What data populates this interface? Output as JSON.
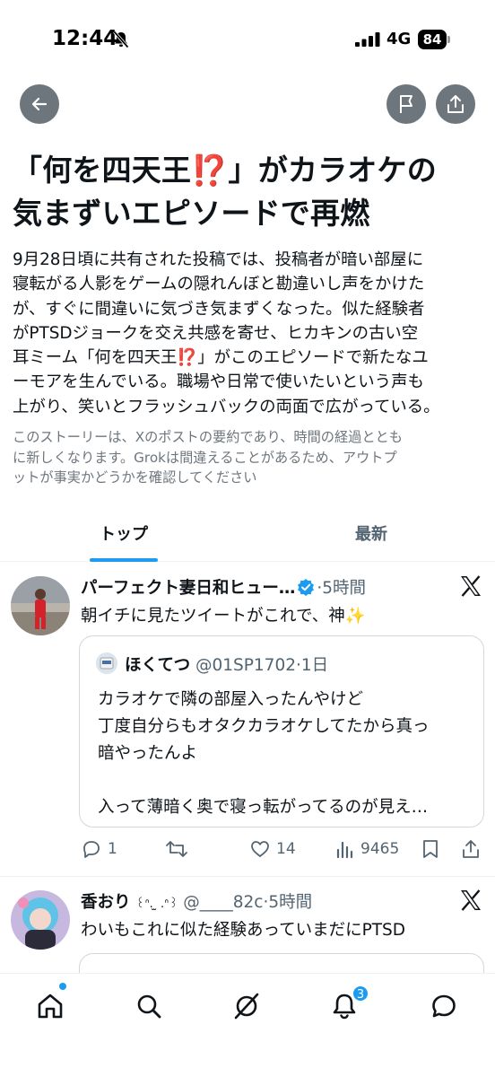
{
  "status_bar": {
    "time": "12:44",
    "network": "4G",
    "battery": "84"
  },
  "headline": {
    "part1": "「何を四天王",
    "emoji": "⁉️",
    "part2": "」がカラオケの",
    "line2": "気まずいエピソードで再燃"
  },
  "summary": {
    "line1": "9月28日頃に共有された投稿では、投稿者が暗い部屋に",
    "line2": "寝転がる人影をゲームの隠れんぼと勘違いし声をかけた",
    "line3": "が、すぐに間違いに気づき気まずくなった。似た経験者",
    "line4": "がPTSDジョークを交え共感を寄せ、ヒカキンの古い空",
    "line5a": "耳ミーム「何を四天王",
    "line5b": "」がこのエピソードで新たなユ",
    "line6": "ーモアを生んでいる。職場や日常で使いたいという声も",
    "line7": "上がり、笑いとフラッシュバックの両面で広がっている。"
  },
  "disclaimer": {
    "line1": "このストーリーは、Xのポストの要約であり、時間の経過ととも",
    "line2": "に新しくなります。Grokは間違えることがあるため、アウトプ",
    "line3": "ットが事実かどうかを確認してください"
  },
  "tabs": [
    {
      "label": "トップ",
      "active": true
    },
    {
      "label": "最新",
      "active": false
    }
  ],
  "posts": [
    {
      "name": "パーフェクト妻日和ヒュー…",
      "meta": "·5時間",
      "text": "朝イチに見たツイートがこれで、神✨",
      "quote": {
        "name": "ほくてつ",
        "meta": "@01SP1702·1日",
        "text": "カラオケで隣の部屋入ったんやけど\n丁度自分らもオタクカラオケしてたから真っ\n暗やったんよ\n\n入って薄暗く奥で寝っ転がってるのが見え…"
      },
      "actions": {
        "replies": "1",
        "retweets": "",
        "likes": "14",
        "views": "9465"
      }
    },
    {
      "name": "香おり",
      "name_extra": "꒰ᐢ. ̫ .ᐢ꒱",
      "meta": "@____82c·5時間",
      "text": "わいもこれに似た経験あっていまだにPTSD"
    }
  ],
  "bottom_nav": {
    "items": [
      "home-icon",
      "search-icon",
      "grok-icon",
      "notifications-icon",
      "messages-icon"
    ],
    "notification_count": "3"
  },
  "colors": {
    "accent": "#1d9bf0",
    "text": "#0f1419",
    "secondary": "#536471",
    "emoji_red": "#e0312f"
  }
}
